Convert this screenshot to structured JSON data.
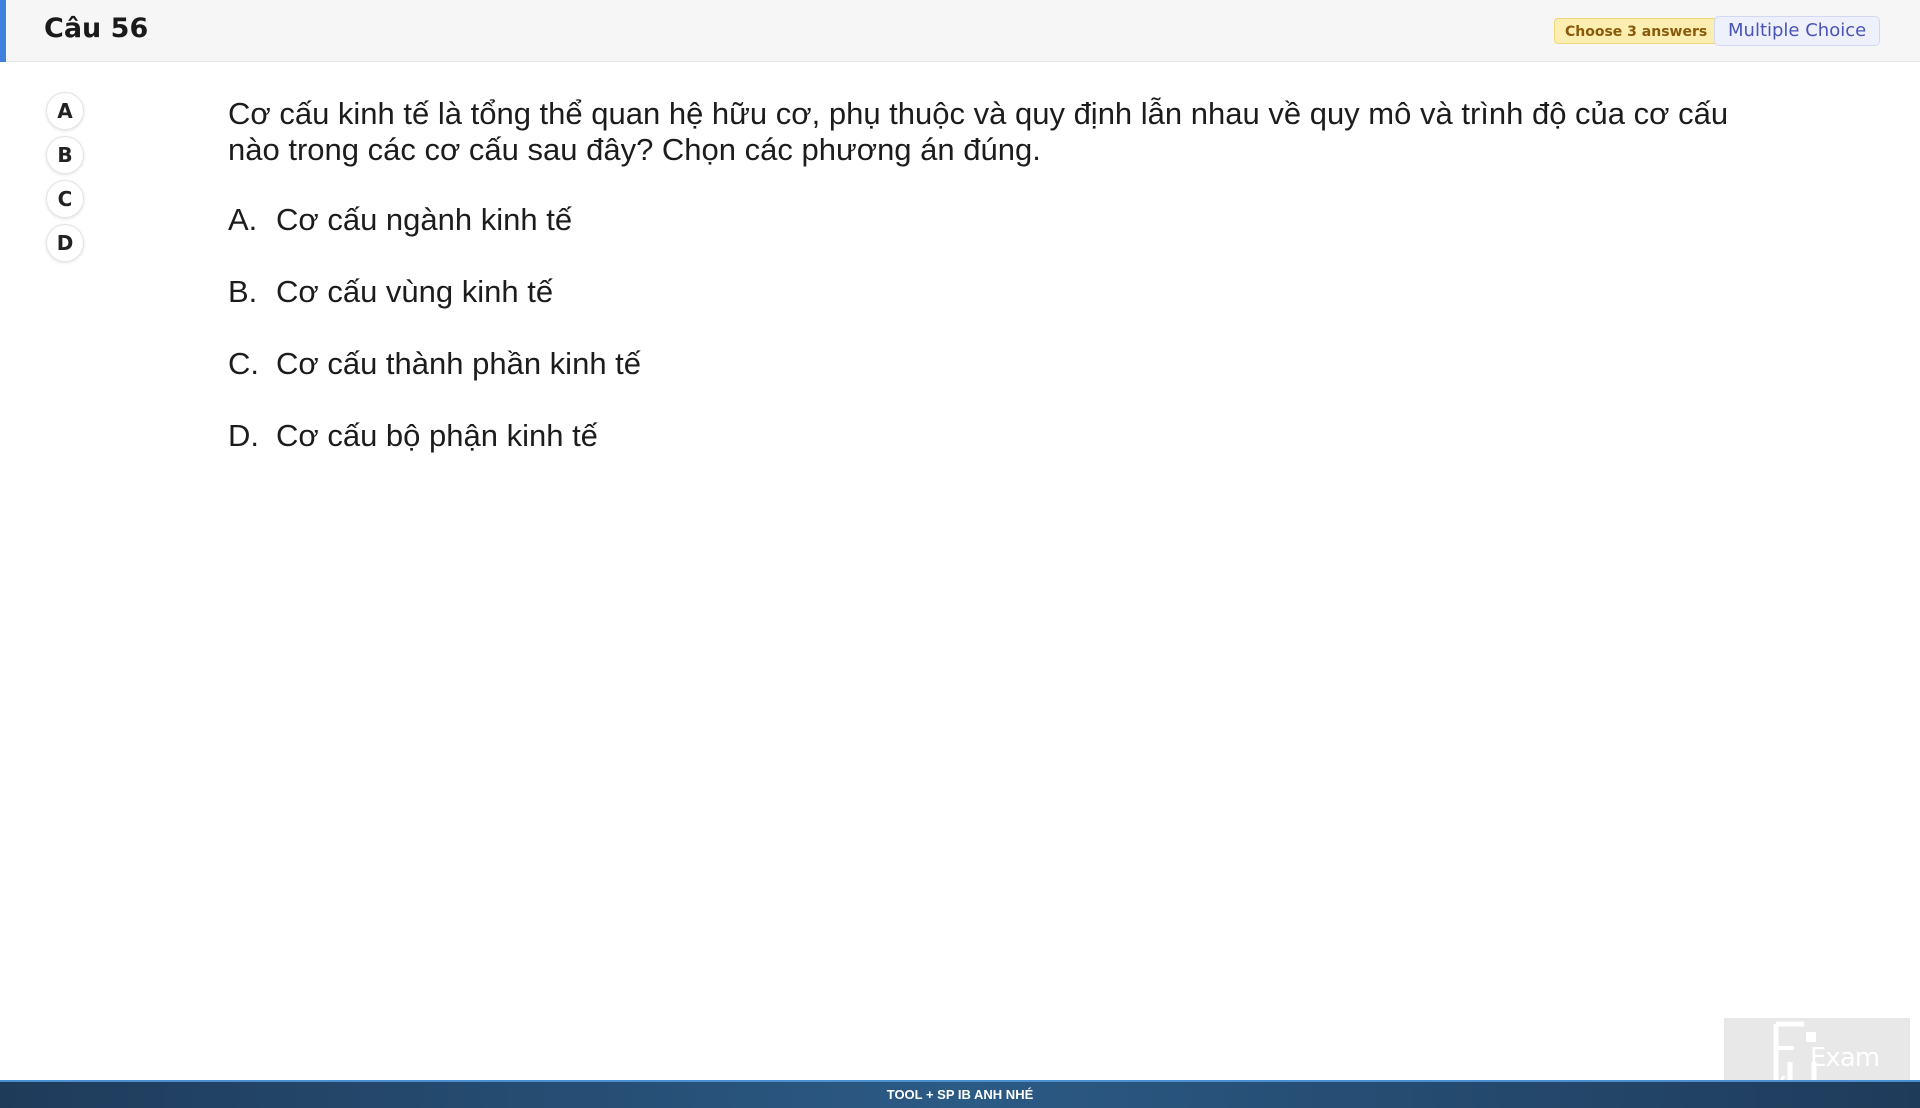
{
  "header": {
    "question_number": "Câu 56",
    "choose_badge": "Choose 3 answers",
    "type_badge": "Multiple Choice",
    "accent_color": "#3f7fe0"
  },
  "answer_selector": [
    "A",
    "B",
    "C",
    "D"
  ],
  "question": {
    "text": "Cơ cấu kinh tế là tổng thể quan hệ hữu cơ, phụ thuộc và quy định lẫn nhau về quy mô và trình độ của cơ cấu nào trong các cơ cấu sau đây? Chọn các phương án đúng.",
    "options": [
      {
        "letter": "A.",
        "text": "Cơ cấu ngành kinh tế"
      },
      {
        "letter": "B.",
        "text": "Cơ cấu vùng kinh tế"
      },
      {
        "letter": "C.",
        "text": "Cơ cấu thành phần kinh tế"
      },
      {
        "letter": "D.",
        "text": "Cơ cấu bộ phận kinh tế"
      }
    ]
  },
  "watermark": {
    "logo_text": "Exam",
    "icon": "fu-exam-logo-icon"
  },
  "footer": {
    "text": "TOOL + SP IB ANH NHÉ"
  }
}
